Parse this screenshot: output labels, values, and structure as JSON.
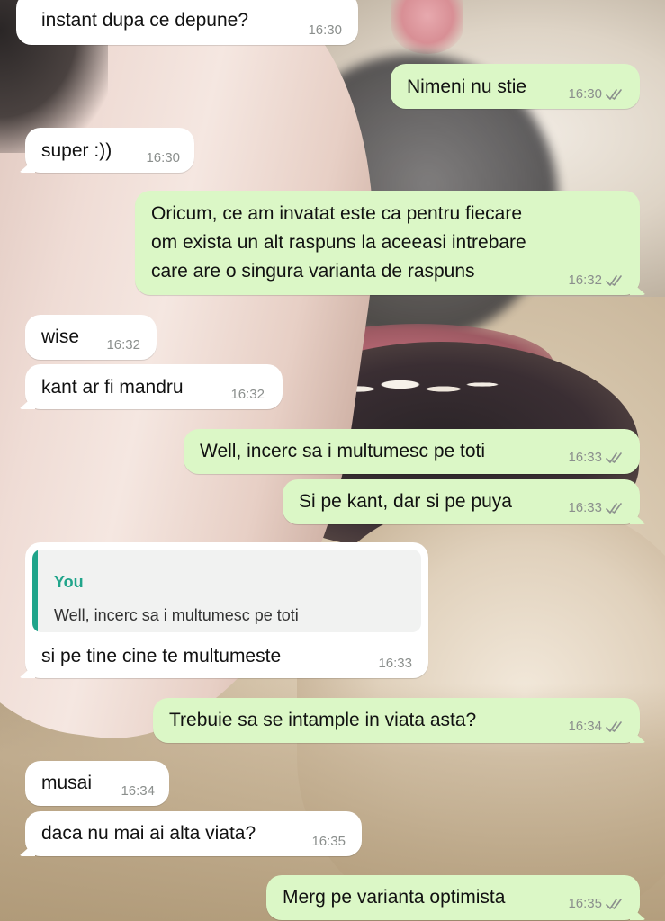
{
  "messages": [
    {
      "id": "m1",
      "dir": "in",
      "text": "instant dupa ce depune?",
      "time": "16:30"
    },
    {
      "id": "m2",
      "dir": "out",
      "text": "Nimeni nu stie",
      "time": "16:30"
    },
    {
      "id": "m3",
      "dir": "in",
      "text": "super :))",
      "time": "16:30"
    },
    {
      "id": "m4",
      "dir": "out",
      "lines": [
        "Oricum, ce am invatat este ca pentru fiecare",
        "om exista un alt raspuns la aceeasi intrebare",
        "care are o singura varianta de raspuns"
      ],
      "time": "16:32"
    },
    {
      "id": "m5",
      "dir": "in",
      "text": "wise",
      "time": "16:32"
    },
    {
      "id": "m6",
      "dir": "in",
      "text": "kant ar fi mandru",
      "time": "16:32"
    },
    {
      "id": "m7",
      "dir": "out",
      "text": "Well, incerc sa i multumesc pe toti",
      "time": "16:33"
    },
    {
      "id": "m8",
      "dir": "out",
      "text": "Si pe kant, dar si pe puya",
      "time": "16:33"
    },
    {
      "id": "m9",
      "dir": "in",
      "quote": {
        "author": "You",
        "text": "Well, incerc sa i multumesc pe toti"
      },
      "text": "si pe tine cine te multumeste",
      "time": "16:33"
    },
    {
      "id": "m10",
      "dir": "out",
      "text": "Trebuie sa se intample in viata asta?",
      "time": "16:34"
    },
    {
      "id": "m11",
      "dir": "in",
      "text": "musai",
      "time": "16:34"
    },
    {
      "id": "m12",
      "dir": "in",
      "text": "daca nu mai ai alta viata?",
      "time": "16:35"
    },
    {
      "id": "m13",
      "dir": "out",
      "text": "Merg pe varianta optimista",
      "time": "16:35"
    }
  ],
  "colors": {
    "incoming_bubble": "#ffffff",
    "outgoing_bubble": "#dbf7c6",
    "timestamp": "#8b8f8d",
    "quote_accent": "#1fa48a",
    "read_ticks": "#8b8f8d"
  },
  "icons": {
    "read_receipt": "double-check-icon"
  }
}
